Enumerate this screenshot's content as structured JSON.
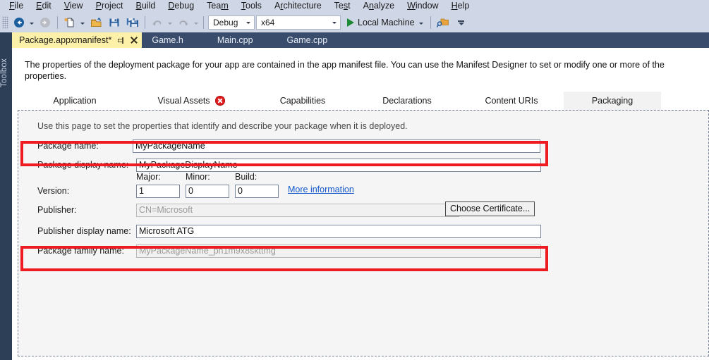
{
  "menubar": {
    "items": [
      {
        "pre": "",
        "acc": "F",
        "post": "ile"
      },
      {
        "pre": "",
        "acc": "E",
        "post": "dit"
      },
      {
        "pre": "",
        "acc": "V",
        "post": "iew"
      },
      {
        "pre": "",
        "acc": "P",
        "post": "roject"
      },
      {
        "pre": "",
        "acc": "B",
        "post": "uild"
      },
      {
        "pre": "",
        "acc": "D",
        "post": "ebug"
      },
      {
        "pre": "Tea",
        "acc": "m",
        "post": ""
      },
      {
        "pre": "",
        "acc": "T",
        "post": "ools"
      },
      {
        "pre": "A",
        "acc": "r",
        "post": "chitecture"
      },
      {
        "pre": "Te",
        "acc": "s",
        "post": "t"
      },
      {
        "pre": "A",
        "acc": "n",
        "post": "alyze"
      },
      {
        "pre": "",
        "acc": "W",
        "post": "indow"
      },
      {
        "pre": "",
        "acc": "H",
        "post": "elp"
      }
    ]
  },
  "toolbar": {
    "navigate_back_label": "Navigate Backward",
    "navigate_forward_label": "Navigate Forward",
    "new_item_label": "New Item",
    "open_file_label": "Open File",
    "save_label": "Save",
    "save_all_label": "Save All",
    "undo_label": "Undo",
    "redo_label": "Redo",
    "configuration": "Debug",
    "platform": "x64",
    "run_target": "Local Machine",
    "find_label": "Find in Files",
    "overflow_label": "Toolbar Options"
  },
  "sidebar": {
    "toolbox_label": "Toolbox"
  },
  "document_tabs": [
    {
      "label": "Package.appxmanifest*",
      "active": true
    },
    {
      "label": "Game.h",
      "active": false
    },
    {
      "label": "Main.cpp",
      "active": false
    },
    {
      "label": "Game.cpp",
      "active": false
    }
  ],
  "designer": {
    "intro": "The properties of the deployment package for your app are contained in the app manifest file. You can use the Manifest Designer to set or modify one or more of the properties.",
    "tabs": [
      {
        "label": "Application",
        "selected": false,
        "error": false
      },
      {
        "label": "Visual Assets",
        "selected": false,
        "error": true
      },
      {
        "label": "Capabilities",
        "selected": false,
        "error": false
      },
      {
        "label": "Declarations",
        "selected": false,
        "error": false
      },
      {
        "label": "Content URIs",
        "selected": false,
        "error": false
      },
      {
        "label": "Packaging",
        "selected": true,
        "error": false
      }
    ],
    "pane_description": "Use this page to set the properties that identify and describe your package when it is deployed.",
    "fields": {
      "package_name_label": "Package name:",
      "package_name_value": "MyPackageName",
      "package_display_name_label": "Package display name:",
      "package_display_name_value": "MyPackageDisplayName",
      "version_label": "Version:",
      "major_label": "Major:",
      "major_value": "1",
      "minor_label": "Minor:",
      "minor_value": "0",
      "build_label": "Build:",
      "build_value": "0",
      "more_information_link": "More information",
      "publisher_label": "Publisher:",
      "publisher_value": "CN=Microsoft",
      "choose_certificate_label": "Choose Certificate...",
      "publisher_display_name_label": "Publisher display name:",
      "publisher_display_name_value": "Microsoft ATG",
      "package_family_name_label": "Package family name:",
      "package_family_name_value": "MyPackageName_ph1m9x8skttmg"
    }
  },
  "annotations": {
    "highlight_color": "#ee1b22",
    "boxes": [
      {
        "name": "package-name-highlight"
      },
      {
        "name": "package-family-name-highlight"
      }
    ]
  }
}
